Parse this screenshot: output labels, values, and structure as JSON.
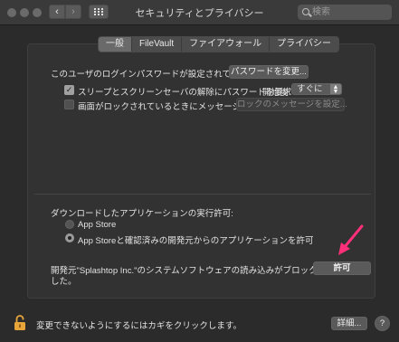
{
  "window": {
    "title": "セキュリティとプライバシー",
    "back_glyph": "‹",
    "forward_glyph": "›",
    "search_placeholder": "検索",
    "icons": [
      "chevron-left-icon",
      "chevron-right-icon",
      "grid-icon",
      "search-icon"
    ]
  },
  "tabs": [
    {
      "label": "一般",
      "selected": true
    },
    {
      "label": "FileVault",
      "selected": false
    },
    {
      "label": "ファイアウォール",
      "selected": false
    },
    {
      "label": "プライバシー",
      "selected": false
    }
  ],
  "general": {
    "password_set_text": "このユーザのログインパスワードが設定されています",
    "change_password_button": "パスワードを変更...",
    "require_password_label": "スリープとスクリーンセーバの解除にパスワードを要求",
    "require_password_checked": true,
    "start_after_label": "開始後:",
    "start_after_value": "すぐに",
    "show_message_label": "画面がロックされているときにメッセージを表示",
    "show_message_checked": false,
    "set_lock_message_button": "ロックのメッセージを設定..."
  },
  "downloads": {
    "heading": "ダウンロードしたアプリケーションの実行許可:",
    "options": [
      {
        "label": "App Store",
        "selected": false
      },
      {
        "label": "App Storeと確認済みの開発元からのアプリケーションを許可",
        "selected": true
      }
    ],
    "blocked_message_line1": "開発元\"Splashtop Inc.\"のシステムソフトウェアの読み込みがブロックされま",
    "blocked_message_line2": "した。",
    "allow_button": "許可",
    "arrow_color": "#ff2f7a"
  },
  "footer": {
    "lock_text": "変更できないようにするにはカギをクリックします。",
    "advanced_button": "詳細...",
    "help_button": "?",
    "icons": [
      "unlocked-padlock-icon",
      "help-icon"
    ],
    "lock_color": "#e8a53a"
  }
}
